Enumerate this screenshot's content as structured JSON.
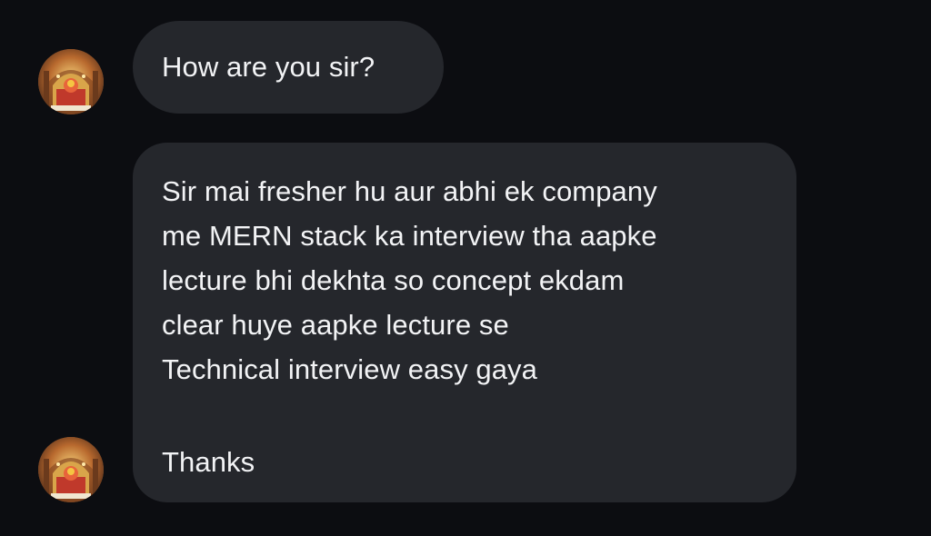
{
  "messages": [
    {
      "avatar_icon": "temple-deity-avatar-icon",
      "text": "How are you sir?"
    },
    {
      "avatar_icon": "temple-deity-avatar-icon",
      "lines": [
        "Sir mai fresher hu aur abhi ek company",
        "me MERN stack ka interview tha aapke",
        "lecture bhi dekhta so concept ekdam",
        "clear huye aapke lecture se",
        "Technical interview easy gaya",
        "Thanks"
      ]
    }
  ],
  "colors": {
    "background": "#0c0d11",
    "bubble": "#25272c",
    "text": "#f2f3f5"
  }
}
